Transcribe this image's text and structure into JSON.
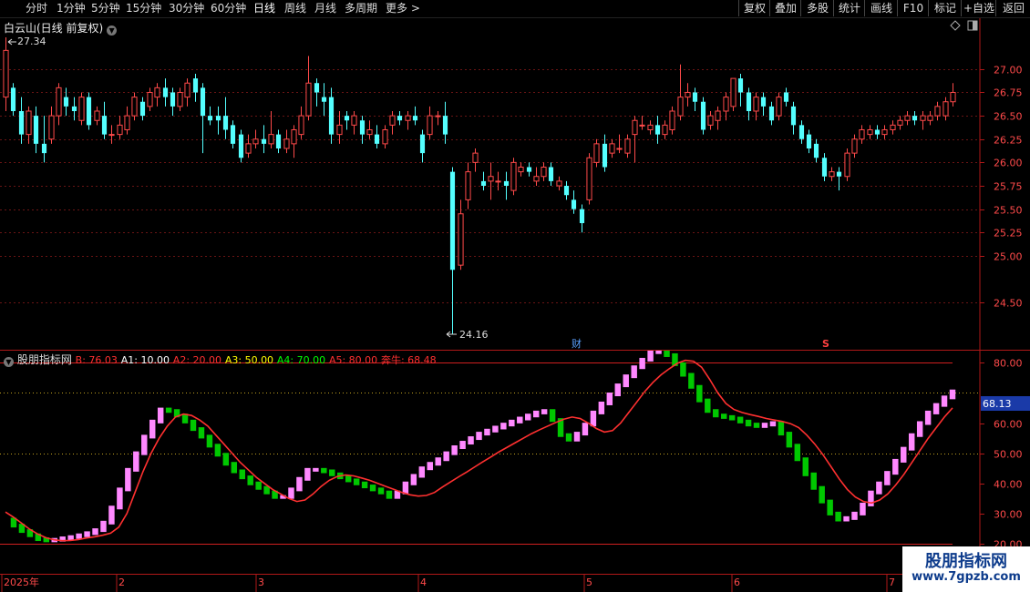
{
  "toolbar": {
    "periods": [
      "分时",
      "1分钟",
      "5分钟",
      "15分钟",
      "30分钟",
      "60分钟",
      "日线",
      "周线",
      "月线",
      "多周期",
      "更多"
    ],
    "active": "日线",
    "more_arrow": ">",
    "right_buttons": [
      "复权",
      "叠加",
      "多股",
      "统计",
      "画线",
      "F10",
      "标记",
      "+自选",
      "返回"
    ]
  },
  "main": {
    "stock_label": "白云山(日线 前复权)",
    "price_axis": [
      "27.00",
      "26.75",
      "26.50",
      "26.25",
      "26.00",
      "25.75",
      "25.50",
      "25.25",
      "25.00",
      "24.50"
    ],
    "high_label": "27.34",
    "low_label": "24.16",
    "marker_cai": "财",
    "marker_s": "S",
    "ylim": [
      24.16,
      27.34
    ],
    "colors": {
      "up": "#ff4a4a",
      "down": "#54ffff",
      "grid": "#7a1a1a"
    }
  },
  "indicator": {
    "name": "股朋指标网",
    "params": [
      {
        "label": "B: 76.03",
        "color": "#ff3030"
      },
      {
        "label": "A1: 10.00",
        "color": "#ffffff"
      },
      {
        "label": "A2: 20.00",
        "color": "#ff3030"
      },
      {
        "label": "A3: 50.00",
        "color": "#ffff00"
      },
      {
        "label": "A4: 70.00",
        "color": "#00ff00"
      },
      {
        "label": "A5: 80.00",
        "color": "#ff3030"
      },
      {
        "label": "奔牛: 68.48",
        "color": "#ff3030"
      }
    ],
    "axis": [
      "80.00",
      "60.00",
      "50.00",
      "40.00",
      "30.00",
      "20.00"
    ],
    "current_value": "68.13",
    "ylim": [
      20,
      84
    ]
  },
  "time_axis": [
    "2025年",
    "2",
    "3",
    "4",
    "5",
    "6",
    "7"
  ],
  "watermark": {
    "title": "股朋指标网",
    "url": "www.7gpzb.com"
  },
  "chart_data": [
    {
      "type": "candlestick",
      "title": "白云山(日线 前复权)",
      "ylim": [
        24.16,
        27.34
      ],
      "high": 27.34,
      "low": 24.16,
      "candles": [
        [
          26.7,
          27.2,
          26.55,
          27.34
        ],
        [
          26.8,
          26.55,
          26.5,
          26.85
        ],
        [
          26.55,
          26.3,
          26.2,
          26.7
        ],
        [
          26.3,
          26.55,
          26.2,
          26.6
        ],
        [
          26.5,
          26.2,
          26.1,
          26.6
        ],
        [
          26.2,
          26.1,
          26.0,
          26.5
        ],
        [
          26.25,
          26.5,
          26.2,
          26.6
        ],
        [
          26.5,
          26.8,
          26.4,
          26.85
        ],
        [
          26.7,
          26.6,
          26.5,
          26.8
        ],
        [
          26.6,
          26.55,
          26.45,
          26.7
        ],
        [
          26.45,
          26.7,
          26.4,
          26.75
        ],
        [
          26.7,
          26.4,
          26.35,
          26.75
        ],
        [
          26.45,
          26.55,
          26.4,
          26.6
        ],
        [
          26.5,
          26.3,
          26.25,
          26.65
        ],
        [
          26.3,
          26.3,
          26.2,
          26.4
        ],
        [
          26.3,
          26.4,
          26.25,
          26.5
        ],
        [
          26.35,
          26.5,
          26.3,
          26.6
        ],
        [
          26.5,
          26.7,
          26.45,
          26.75
        ],
        [
          26.65,
          26.5,
          26.45,
          26.7
        ],
        [
          26.6,
          26.75,
          26.55,
          26.8
        ],
        [
          26.7,
          26.8,
          26.6,
          26.85
        ],
        [
          26.8,
          26.7,
          26.6,
          26.9
        ],
        [
          26.75,
          26.6,
          26.5,
          26.8
        ],
        [
          26.6,
          26.75,
          26.55,
          26.8
        ],
        [
          26.7,
          26.85,
          26.6,
          26.9
        ],
        [
          26.9,
          26.75,
          26.65,
          26.95
        ],
        [
          26.8,
          26.5,
          26.1,
          26.85
        ],
        [
          26.5,
          26.45,
          26.4,
          26.6
        ],
        [
          26.5,
          26.45,
          26.3,
          26.6
        ],
        [
          26.5,
          26.35,
          26.25,
          26.7
        ],
        [
          26.4,
          26.2,
          26.15,
          26.45
        ],
        [
          26.3,
          26.05,
          26.0,
          26.35
        ],
        [
          26.1,
          26.2,
          26.05,
          26.3
        ],
        [
          26.2,
          26.25,
          26.15,
          26.35
        ],
        [
          26.25,
          26.2,
          26.1,
          26.4
        ],
        [
          26.2,
          26.3,
          26.15,
          26.55
        ],
        [
          26.3,
          26.15,
          26.1,
          26.35
        ],
        [
          26.15,
          26.25,
          26.1,
          26.35
        ],
        [
          26.2,
          26.35,
          26.05,
          26.4
        ],
        [
          26.3,
          26.5,
          26.25,
          26.6
        ],
        [
          26.5,
          26.85,
          26.45,
          27.14
        ],
        [
          26.85,
          26.75,
          26.6,
          26.9
        ],
        [
          26.7,
          26.65,
          26.5,
          26.85
        ],
        [
          26.7,
          26.3,
          26.2,
          26.8
        ],
        [
          26.3,
          26.4,
          26.2,
          26.55
        ],
        [
          26.5,
          26.45,
          26.35,
          26.55
        ],
        [
          26.4,
          26.5,
          26.3,
          26.55
        ],
        [
          26.45,
          26.3,
          26.2,
          26.5
        ],
        [
          26.3,
          26.35,
          26.25,
          26.45
        ],
        [
          26.3,
          26.2,
          26.15,
          26.4
        ],
        [
          26.2,
          26.35,
          26.15,
          26.4
        ],
        [
          26.4,
          26.5,
          26.3,
          26.55
        ],
        [
          26.5,
          26.45,
          26.4,
          26.55
        ],
        [
          26.45,
          26.5,
          26.35,
          26.55
        ],
        [
          26.5,
          26.45,
          26.4,
          26.6
        ],
        [
          26.3,
          26.1,
          26.0,
          26.35
        ],
        [
          26.3,
          26.5,
          26.25,
          26.6
        ],
        [
          26.5,
          26.5,
          26.4,
          26.55
        ],
        [
          26.5,
          26.3,
          26.2,
          26.65
        ],
        [
          25.9,
          24.85,
          24.16,
          25.95
        ],
        [
          24.9,
          25.45,
          24.85,
          25.6
        ],
        [
          25.6,
          25.9,
          25.5,
          26.0
        ],
        [
          26.0,
          26.1,
          25.9,
          26.15
        ],
        [
          25.8,
          25.75,
          25.7,
          25.9
        ],
        [
          25.8,
          25.85,
          25.6,
          26.0
        ],
        [
          25.8,
          25.8,
          25.7,
          25.9
        ],
        [
          25.8,
          25.75,
          25.6,
          25.9
        ],
        [
          25.7,
          26.0,
          25.65,
          26.05
        ],
        [
          25.9,
          25.95,
          25.85,
          26.0
        ],
        [
          25.95,
          25.9,
          25.85,
          26.0
        ],
        [
          25.8,
          25.85,
          25.75,
          25.95
        ],
        [
          25.85,
          25.95,
          25.8,
          26.0
        ],
        [
          25.95,
          25.8,
          25.75,
          26.0
        ],
        [
          25.75,
          25.8,
          25.7,
          25.85
        ],
        [
          25.75,
          25.65,
          25.6,
          25.8
        ],
        [
          25.6,
          25.5,
          25.45,
          25.7
        ],
        [
          25.5,
          25.35,
          25.25,
          25.55
        ],
        [
          25.6,
          26.05,
          25.55,
          26.1
        ],
        [
          26.0,
          26.2,
          25.95,
          26.25
        ],
        [
          26.2,
          25.95,
          25.9,
          26.3
        ],
        [
          26.1,
          26.2,
          26.05,
          26.25
        ],
        [
          26.15,
          26.15,
          26.1,
          26.3
        ],
        [
          26.1,
          26.25,
          26.05,
          26.3
        ],
        [
          26.3,
          26.45,
          26.0,
          26.5
        ],
        [
          26.4,
          26.4,
          26.35,
          26.5
        ],
        [
          26.35,
          26.4,
          26.3,
          26.45
        ],
        [
          26.4,
          26.3,
          26.2,
          26.5
        ],
        [
          26.3,
          26.4,
          26.25,
          26.45
        ],
        [
          26.35,
          26.55,
          26.3,
          26.6
        ],
        [
          26.5,
          26.7,
          26.45,
          27.05
        ],
        [
          26.7,
          26.75,
          26.6,
          26.85
        ],
        [
          26.75,
          26.65,
          26.55,
          26.8
        ],
        [
          26.65,
          26.35,
          26.3,
          26.7
        ],
        [
          26.4,
          26.5,
          26.35,
          26.55
        ],
        [
          26.45,
          26.55,
          26.35,
          26.6
        ],
        [
          26.55,
          26.7,
          26.45,
          26.75
        ],
        [
          26.6,
          26.9,
          26.55,
          26.9
        ],
        [
          26.9,
          26.75,
          26.6,
          26.95
        ],
        [
          26.75,
          26.55,
          26.45,
          26.8
        ],
        [
          26.55,
          26.7,
          26.45,
          26.75
        ],
        [
          26.7,
          26.6,
          26.5,
          26.75
        ],
        [
          26.6,
          26.45,
          26.4,
          26.65
        ],
        [
          26.5,
          26.7,
          26.45,
          26.75
        ],
        [
          26.75,
          26.65,
          26.6,
          26.8
        ],
        [
          26.6,
          26.4,
          26.3,
          26.65
        ],
        [
          26.4,
          26.25,
          26.2,
          26.45
        ],
        [
          26.3,
          26.15,
          26.1,
          26.35
        ],
        [
          26.2,
          26.05,
          26.0,
          26.25
        ],
        [
          26.05,
          25.85,
          25.8,
          26.1
        ],
        [
          25.85,
          25.9,
          25.8,
          25.95
        ],
        [
          25.9,
          25.85,
          25.7,
          25.95
        ],
        [
          25.85,
          26.1,
          25.8,
          26.15
        ],
        [
          26.1,
          26.25,
          26.05,
          26.3
        ],
        [
          26.25,
          26.35,
          26.2,
          26.4
        ],
        [
          26.3,
          26.35,
          26.25,
          26.4
        ],
        [
          26.35,
          26.3,
          26.25,
          26.4
        ],
        [
          26.3,
          26.35,
          26.25,
          26.4
        ],
        [
          26.35,
          26.4,
          26.3,
          26.45
        ],
        [
          26.4,
          26.45,
          26.35,
          26.5
        ],
        [
          26.45,
          26.5,
          26.4,
          26.55
        ],
        [
          26.5,
          26.45,
          26.4,
          26.55
        ],
        [
          26.45,
          26.5,
          26.35,
          26.55
        ],
        [
          26.45,
          26.5,
          26.4,
          26.55
        ],
        [
          26.5,
          26.6,
          26.45,
          26.65
        ],
        [
          26.5,
          26.65,
          26.45,
          26.7
        ],
        [
          26.65,
          26.75,
          26.6,
          26.85
        ]
      ]
    },
    {
      "type": "line",
      "title": "股朋指标网",
      "ylim": [
        20,
        84
      ],
      "series": [
        {
          "name": "B",
          "color": "#ff3030",
          "values": [
            30.5,
            28.8,
            26.8,
            24.8,
            23.2,
            22.0,
            21.3,
            21.0,
            21.1,
            21.4,
            21.9,
            22.3,
            22.8,
            23.5,
            25.5,
            30,
            37,
            44,
            50,
            55,
            59,
            62,
            63,
            62.5,
            61,
            59,
            56,
            53,
            50,
            47,
            44.5,
            42,
            40,
            38,
            36.5,
            35,
            34,
            34.5,
            36.5,
            39,
            41,
            42.3,
            42.8,
            42.5,
            41.8,
            41,
            40,
            39,
            38,
            37,
            36.2,
            35.8,
            36,
            37,
            38.8,
            40.5,
            42.2,
            43.8,
            45.5,
            47.2,
            48.8,
            50.5,
            52,
            53.5,
            55,
            56.5,
            57.8,
            59,
            60.2,
            61.3,
            62,
            61.5,
            60,
            58.2,
            57,
            57.5,
            60,
            63.5,
            67,
            70.5,
            73.5,
            76,
            78,
            79.8,
            80.8,
            80.5,
            78.5,
            74.5,
            70,
            66.5,
            64.5,
            63.5,
            62.8,
            62.2,
            61.5,
            61,
            60.5,
            59.8,
            58.5,
            56,
            53,
            49.5,
            45.5,
            41.5,
            38,
            35.5,
            34,
            33.5,
            34.5,
            36.5,
            39.5,
            43,
            47,
            51,
            55,
            58.5,
            62,
            65
          ]
        },
        {
          "name": "奔牛",
          "values": [
            28.0,
            26.0,
            24.2,
            22.8,
            21.5,
            21.1,
            21.3,
            21.8,
            22.2,
            22.8,
            23.5,
            24.5,
            27.0,
            32.0,
            38.0,
            44.5,
            50.0,
            55.5,
            60.5,
            64.5,
            64.0,
            62.5,
            60.5,
            58.0,
            55.5,
            52.5,
            49.5,
            46.5,
            44.0,
            42.0,
            40.0,
            38.5,
            37.0,
            35.5,
            35.5,
            38.0,
            41.5,
            44.5,
            44.5,
            44.0,
            43.0,
            42.0,
            41.0,
            40.0,
            39.0,
            38.0,
            37.0,
            35.5,
            37.0,
            40.0,
            42.5,
            45.0,
            46.5,
            48.0,
            50.0,
            52.0,
            53.5,
            55.0,
            56.5,
            57.5,
            58.5,
            59.5,
            60.5,
            61.5,
            62.5,
            63.5,
            64.0,
            61.0,
            56.0,
            54.5,
            56.5,
            59.5,
            63.5,
            66.5,
            69.5,
            72.5,
            75.5,
            78.5,
            81.0,
            83.5,
            84.0,
            82.5,
            79.5,
            76.0,
            72.0,
            67.5,
            64.0,
            62.5,
            62.0,
            61.5,
            60.5,
            59.5,
            59.0,
            59.5,
            60.0,
            56.5,
            52.5,
            48.0,
            43.0,
            38.5,
            34.0,
            30.0,
            28.0,
            28.5,
            30.0,
            33.0,
            37.0,
            40.0,
            43.5,
            47.5,
            51.5,
            56.0,
            60.0,
            63.5,
            66.0,
            68.5,
            70.5
          ]
        }
      ]
    }
  ]
}
